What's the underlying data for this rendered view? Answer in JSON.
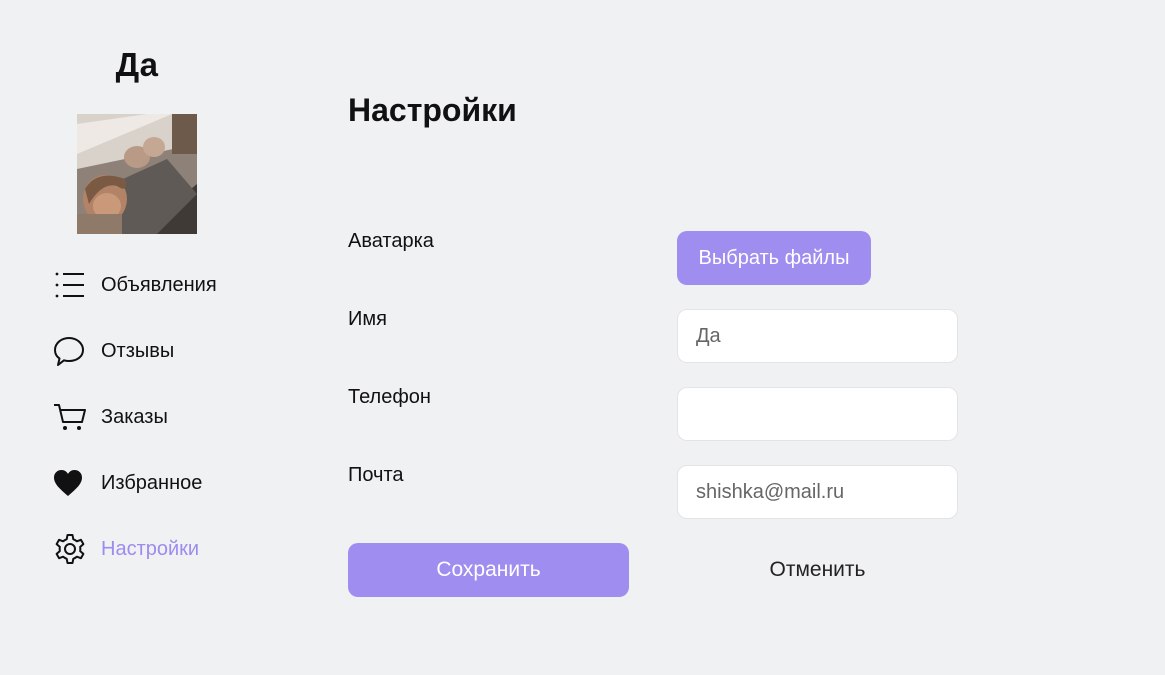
{
  "user": {
    "name": "Да"
  },
  "sidebar": {
    "items": [
      {
        "label": "Объявления",
        "icon": "list-icon"
      },
      {
        "label": "Отзывы",
        "icon": "chat-bubble-icon"
      },
      {
        "label": "Заказы",
        "icon": "cart-icon"
      },
      {
        "label": "Избранное",
        "icon": "heart-icon"
      },
      {
        "label": "Настройки",
        "icon": "gear-icon",
        "active": true
      }
    ]
  },
  "main": {
    "title": "Настройки",
    "form": {
      "avatar_label": "Аватарка",
      "choose_files_label": "Выбрать файлы",
      "name_label": "Имя",
      "name_value": "Да",
      "phone_label": "Телефон",
      "phone_value": "",
      "email_label": "Почта",
      "email_value": "shishka@mail.ru",
      "save_label": "Сохранить",
      "cancel_label": "Отменить"
    }
  },
  "colors": {
    "accent": "#9f8ef0",
    "active_text": "#9c8cee",
    "background": "#f0f1f3"
  }
}
